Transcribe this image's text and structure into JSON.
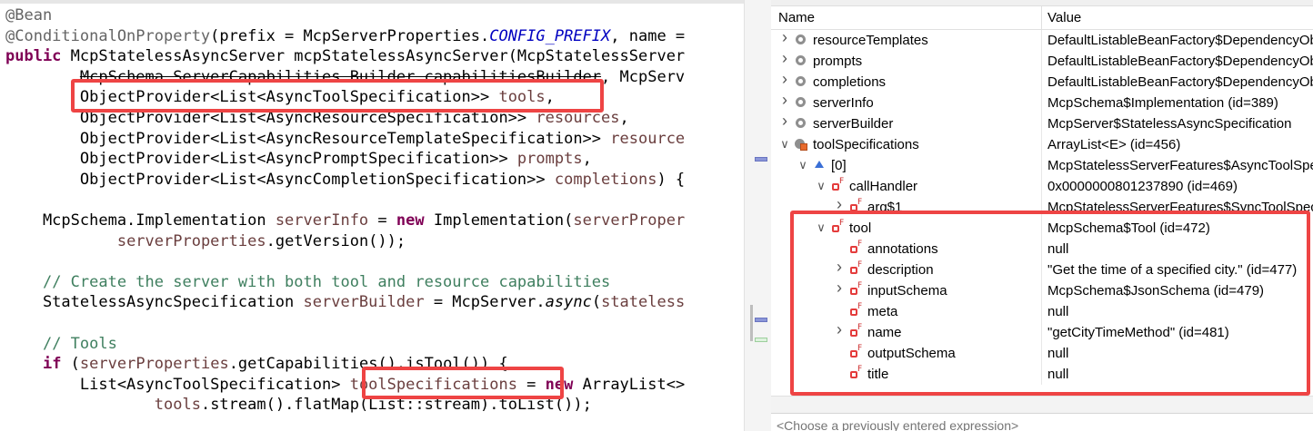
{
  "editor": {
    "lines": [
      [
        {
          "t": "@Bean",
          "c": "ann"
        }
      ],
      [
        {
          "t": "@ConditionalOnProperty",
          "c": "ann"
        },
        {
          "t": "(prefix = McpServerProperties."
        },
        {
          "t": "CONFIG_PREFIX",
          "c": "field"
        },
        {
          "t": ", name = "
        }
      ],
      [
        {
          "t": "public",
          "c": "kw"
        },
        {
          "t": " McpStatelessAsyncServer mcpStatelessAsyncServer(McpStatelessServer"
        }
      ],
      [
        {
          "t": "        "
        },
        {
          "t": "McpSchema.ServerCapabilities.Builder capabilitiesBuilder",
          "c": "strike"
        },
        {
          "t": ", McpServ"
        }
      ],
      [
        {
          "t": "        ObjectProvider<List<AsyncToolSpecification>> "
        },
        {
          "t": "tools",
          "c": "var"
        },
        {
          "t": ","
        }
      ],
      [
        {
          "t": "        ObjectProvider<List<AsyncResourceSpecification>> "
        },
        {
          "t": "resources",
          "c": "var"
        },
        {
          "t": ","
        }
      ],
      [
        {
          "t": "        ObjectProvider<List<AsyncResourceTemplateSpecification>> "
        },
        {
          "t": "resource",
          "c": "var"
        }
      ],
      [
        {
          "t": "        ObjectProvider<List<AsyncPromptSpecification>> "
        },
        {
          "t": "prompts",
          "c": "var"
        },
        {
          "t": ","
        }
      ],
      [
        {
          "t": "        ObjectProvider<List<AsyncCompletionSpecification>> "
        },
        {
          "t": "completions",
          "c": "var"
        },
        {
          "t": ") {"
        }
      ],
      [
        {
          "t": ""
        }
      ],
      [
        {
          "t": "    McpSchema.Implementation "
        },
        {
          "t": "serverInfo",
          "c": "var"
        },
        {
          "t": " = "
        },
        {
          "t": "new",
          "c": "kw"
        },
        {
          "t": " Implementation("
        },
        {
          "t": "serverProper",
          "c": "var"
        }
      ],
      [
        {
          "t": "            "
        },
        {
          "t": "serverProperties",
          "c": "var"
        },
        {
          "t": ".getVersion());"
        }
      ],
      [
        {
          "t": ""
        }
      ],
      [
        {
          "t": "    "
        },
        {
          "t": "// Create the server with both tool and resource capabilities",
          "c": "com"
        }
      ],
      [
        {
          "t": "    StatelessAsyncSpecification "
        },
        {
          "t": "serverBuilder",
          "c": "var"
        },
        {
          "t": " = McpServer."
        },
        {
          "t": "async",
          "c": "italic"
        },
        {
          "t": "("
        },
        {
          "t": "stateless",
          "c": "var"
        }
      ],
      [
        {
          "t": ""
        }
      ],
      [
        {
          "t": "    "
        },
        {
          "t": "// Tools",
          "c": "com"
        }
      ],
      [
        {
          "t": "    "
        },
        {
          "t": "if",
          "c": "kw"
        },
        {
          "t": " ("
        },
        {
          "t": "serverProperties",
          "c": "var"
        },
        {
          "t": ".getCapabilities().isTool()) {"
        }
      ],
      [
        {
          "t": "        List<AsyncToolSpecification> "
        },
        {
          "t": "toolSpecifications",
          "c": "var"
        },
        {
          "t": " = "
        },
        {
          "t": "new",
          "c": "kw"
        },
        {
          "t": " ArrayList<>"
        }
      ],
      [
        {
          "t": "                "
        },
        {
          "t": "tools",
          "c": "var"
        },
        {
          "t": ".stream().flatMap(List::stream).toList());"
        }
      ]
    ]
  },
  "variables": {
    "columns": {
      "name": "Name",
      "value": "Value"
    },
    "rows": [
      {
        "depth": 0,
        "twisty": "collapsed",
        "icon": "private-field-icon",
        "name": "resourceTemplates",
        "value": "DefaultListableBeanFactory$DependencyObjectProvider"
      },
      {
        "depth": 0,
        "twisty": "collapsed",
        "icon": "private-field-icon",
        "name": "prompts",
        "value": "DefaultListableBeanFactory$DependencyObjectProvider"
      },
      {
        "depth": 0,
        "twisty": "collapsed",
        "icon": "private-field-icon",
        "name": "completions",
        "value": "DefaultListableBeanFactory$DependencyObjectProvider"
      },
      {
        "depth": 0,
        "twisty": "collapsed",
        "icon": "private-field-icon",
        "name": "serverInfo",
        "value": "McpSchema$Implementation  (id=389)"
      },
      {
        "depth": 0,
        "twisty": "collapsed",
        "icon": "private-field-icon",
        "name": "serverBuilder",
        "value": "McpServer$StatelessAsyncSpecification"
      },
      {
        "depth": 0,
        "twisty": "expanded",
        "icon": "local-variable-icon",
        "name": "toolSpecifications",
        "value": "ArrayList<E>  (id=456)"
      },
      {
        "depth": 1,
        "twisty": "expanded",
        "icon": "array-element-icon",
        "name": "[0]",
        "value": "McpStatelessServerFeatures$AsyncToolSpecification"
      },
      {
        "depth": 2,
        "twisty": "expanded",
        "icon": "final-field-icon",
        "name": "callHandler",
        "value": "0x0000000801237890  (id=469)"
      },
      {
        "depth": 3,
        "twisty": "collapsed",
        "icon": "final-field-icon",
        "name": "arg$1",
        "value": "McpStatelessServerFeatures$SyncToolSpecification"
      },
      {
        "depth": 2,
        "twisty": "expanded",
        "icon": "final-field-icon",
        "name": "tool",
        "value": "McpSchema$Tool  (id=472)"
      },
      {
        "depth": 3,
        "twisty": "none",
        "icon": "final-field-icon",
        "name": "annotations",
        "value": "null"
      },
      {
        "depth": 3,
        "twisty": "collapsed",
        "icon": "final-field-icon",
        "name": "description",
        "value": "\"Get the time of a specified city.\" (id=477)"
      },
      {
        "depth": 3,
        "twisty": "collapsed",
        "icon": "final-field-icon",
        "name": "inputSchema",
        "value": "McpSchema$JsonSchema  (id=479)"
      },
      {
        "depth": 3,
        "twisty": "none",
        "icon": "final-field-icon",
        "name": "meta",
        "value": "null"
      },
      {
        "depth": 3,
        "twisty": "collapsed",
        "icon": "final-field-icon",
        "name": "name",
        "value": "\"getCityTimeMethod\" (id=481)"
      },
      {
        "depth": 3,
        "twisty": "none",
        "icon": "final-field-icon",
        "name": "outputSchema",
        "value": "null"
      },
      {
        "depth": 3,
        "twisty": "none",
        "icon": "final-field-icon",
        "name": "title",
        "value": "null"
      }
    ],
    "expression_placeholder": "<Choose a previously entered expression>"
  },
  "colors": {
    "highlight": "#ee4444",
    "keyword": "#7f0055",
    "comment": "#3f7f5f",
    "annotation": "#646464",
    "local_var": "#6a3e3e",
    "static_field": "#0000c0"
  }
}
